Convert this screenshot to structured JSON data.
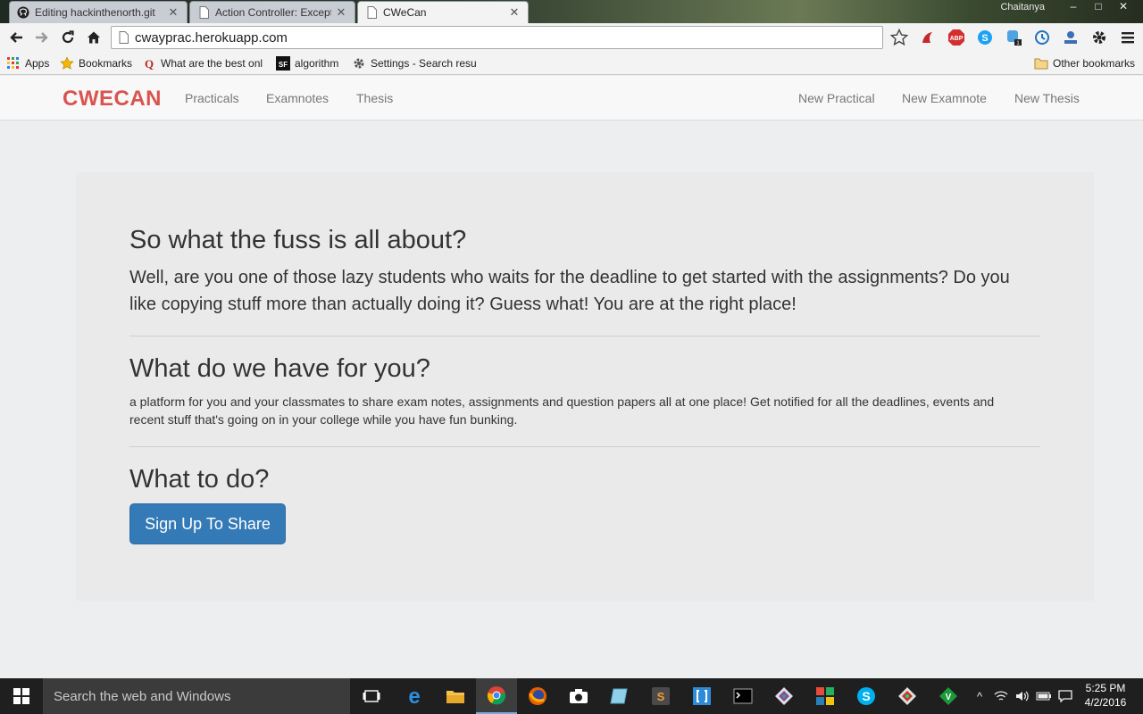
{
  "browser": {
    "tabs": [
      {
        "title": "Editing hackinthenorth.git",
        "icon": "github-icon"
      },
      {
        "title": "Action Controller: Exceptio",
        "icon": "page-icon"
      },
      {
        "title": "CWeCan",
        "icon": "page-icon",
        "active": true
      }
    ],
    "user": "Chaitanya",
    "url": "cwayprac.herokuapp.com",
    "bookmarks": [
      {
        "label": "Apps",
        "icon": "apps-grid-icon"
      },
      {
        "label": "Bookmarks",
        "icon": "star-icon"
      },
      {
        "label": "What are the best onl",
        "icon": "quora-icon"
      },
      {
        "label": "algorithm",
        "icon": "sf-icon"
      },
      {
        "label": "Settings - Search resu",
        "icon": "gear-icon"
      }
    ],
    "other_bookmarks": "Other bookmarks"
  },
  "site": {
    "brand": "CWECAN",
    "nav_left": [
      "Practicals",
      "Examnotes",
      "Thesis"
    ],
    "nav_right": [
      "New Practical",
      "New Examnote",
      "New Thesis"
    ],
    "brand_color": "#d9534f"
  },
  "main": {
    "section1": {
      "heading": "So what the fuss is all about?",
      "text": "Well, are you one of those lazy students who waits for the deadline to get started with the assignments? Do you like copying stuff more than actually doing it? Guess what! You are at the right place!"
    },
    "section2": {
      "heading": "What do we have for you?",
      "text": "a platform for you and your classmates to share exam notes, assignments and question papers all at one place! Get notified for all the deadlines, events and recent stuff that's going on in your college while you have fun bunking."
    },
    "section3": {
      "heading": "What to do?",
      "button": "Sign Up To Share"
    },
    "button_color": "#337ab7"
  },
  "taskbar": {
    "search_placeholder": "Search the web and Windows",
    "time": "5:25 PM",
    "date": "4/2/2016"
  }
}
